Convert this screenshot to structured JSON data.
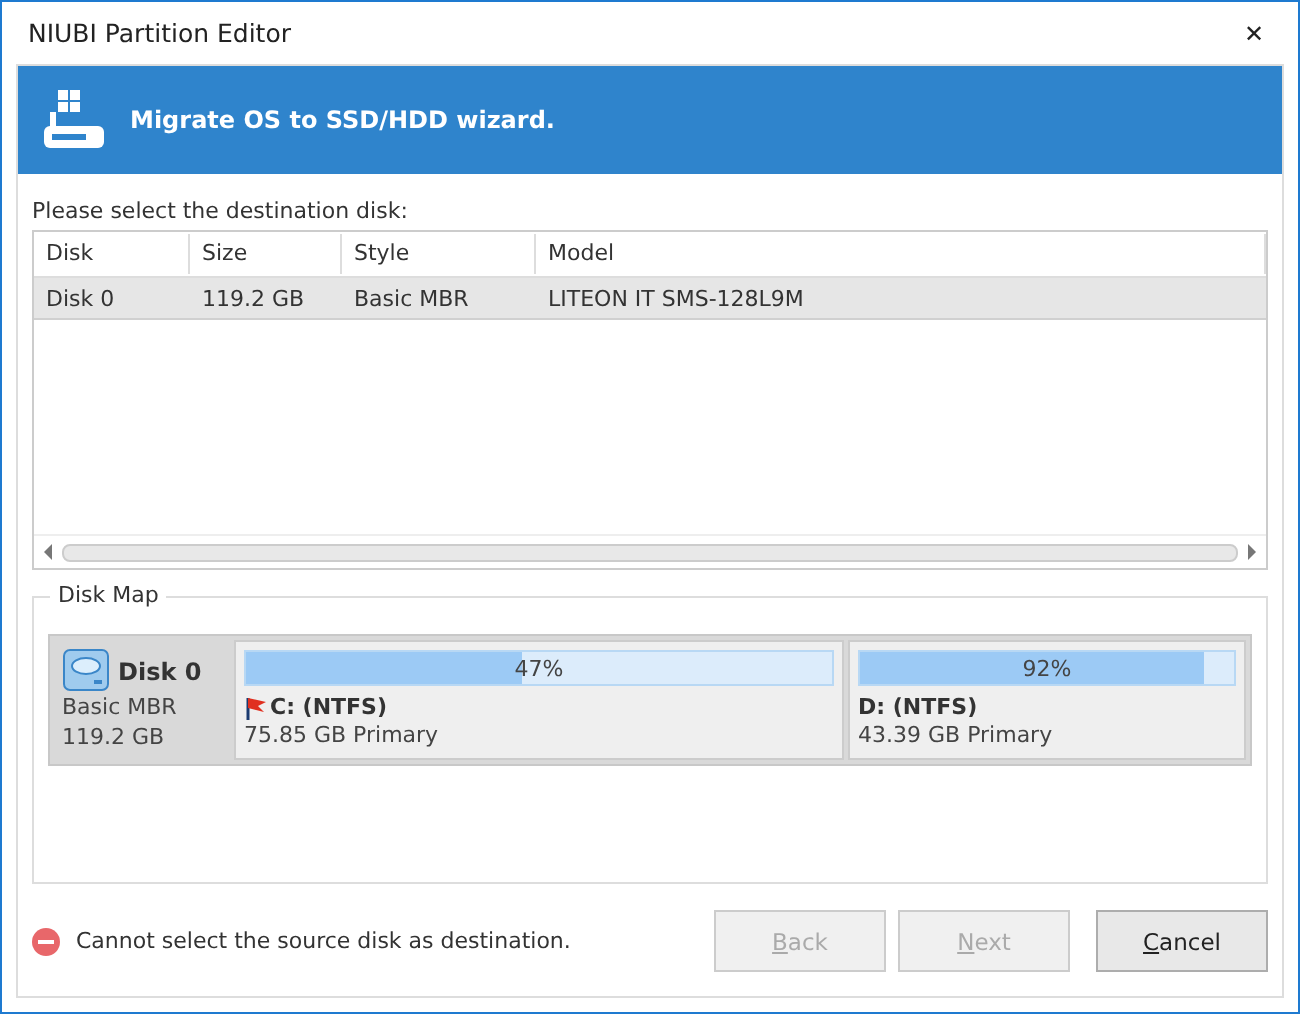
{
  "window": {
    "title": "NIUBI Partition Editor",
    "close": "✕"
  },
  "header": {
    "title": "Migrate OS to SSD/HDD wizard."
  },
  "prompt": "Please select the destination disk:",
  "table": {
    "columns": [
      "Disk",
      "Size",
      "Style",
      "Model"
    ],
    "rows": [
      {
        "cells": [
          "Disk 0",
          "119.2 GB",
          "Basic MBR",
          "LITEON IT SMS-128L9M"
        ],
        "selected": true
      }
    ]
  },
  "disk_map": {
    "title": "Disk Map",
    "disk": {
      "name": "Disk 0",
      "style": "Basic MBR",
      "size": "119.2 GB"
    },
    "partitions": [
      {
        "percent": "47%",
        "level": 0.47,
        "label": "C: (NTFS)",
        "detail": "75.85 GB Primary",
        "system": true
      },
      {
        "percent": "92%",
        "level": 0.92,
        "label": "D: (NTFS)",
        "detail": "43.39 GB Primary",
        "system": false
      }
    ]
  },
  "status": "Cannot select the source disk as destination.",
  "buttons": [
    {
      "label": "Back",
      "disabled": true
    },
    {
      "label": "Next",
      "disabled": true
    },
    {
      "label": "Cancel",
      "disabled": false
    }
  ]
}
